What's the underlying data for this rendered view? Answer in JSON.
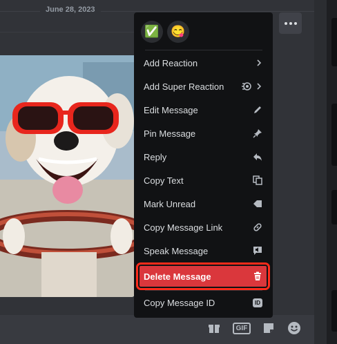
{
  "message": {
    "date": "June 28, 2023"
  },
  "context_menu": {
    "quick_reactions": [
      {
        "emoji": "✅",
        "icon": "check-mark-emoji"
      },
      {
        "emoji": "😋",
        "icon": "yum-face-emoji"
      }
    ],
    "items": [
      {
        "label": "Add Reaction",
        "icon": "chevron-right-icon"
      },
      {
        "label": "Add Super Reaction",
        "icon": "super-reaction-icon"
      },
      {
        "label": "Edit Message",
        "icon": "pencil-icon"
      },
      {
        "label": "Pin Message",
        "icon": "pin-icon"
      },
      {
        "label": "Reply",
        "icon": "reply-arrow-icon"
      },
      {
        "label": "Copy Text",
        "icon": "copy-icon"
      },
      {
        "label": "Mark Unread",
        "icon": "mark-unread-icon"
      },
      {
        "label": "Copy Message Link",
        "icon": "link-icon"
      },
      {
        "label": "Speak Message",
        "icon": "speak-icon"
      },
      {
        "label": "Delete Message",
        "icon": "trash-icon"
      },
      {
        "label": "Copy Message ID",
        "icon": "id-badge-icon",
        "badge": "ID"
      }
    ]
  },
  "composer": {
    "gif_label": "GIF"
  },
  "colors": {
    "danger": "#da373c",
    "highlight_outline": "#ff2b1a",
    "menu_bg": "#111214"
  }
}
